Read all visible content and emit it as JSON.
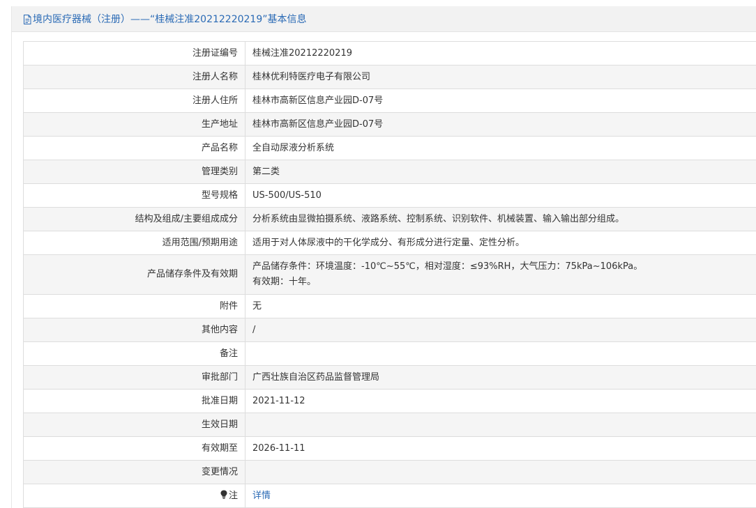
{
  "header": {
    "title": "境内医疗器械（注册）——“桂械注准20212220219”基本信息"
  },
  "rows": [
    {
      "label": "注册证编号",
      "value": "桂械注准20212220219"
    },
    {
      "label": "注册人名称",
      "value": "桂林优利特医疗电子有限公司"
    },
    {
      "label": "注册人住所",
      "value": "桂林市高新区信息产业园D-07号"
    },
    {
      "label": "生产地址",
      "value": "桂林市高新区信息产业园D-07号"
    },
    {
      "label": "产品名称",
      "value": "全自动尿液分析系统"
    },
    {
      "label": "管理类别",
      "value": "第二类"
    },
    {
      "label": "型号规格",
      "value": "US-500/US-510"
    },
    {
      "label": "结构及组成/主要组成成分",
      "value": "分析系统由显微拍摄系统、液路系统、控制系统、识别软件、机械装置、输入输出部分组成。"
    },
    {
      "label": "适用范围/预期用途",
      "value": "适用于对人体尿液中的干化学成分、有形成分进行定量、定性分析。"
    },
    {
      "label": "产品储存条件及有效期",
      "value_line1": "产品储存条件：环境温度：-10℃~55℃，相对湿度：≤93%RH，大气压力：75kPa~106kPa。",
      "value_line2": "有效期：十年。"
    },
    {
      "label": "附件",
      "value": "无"
    },
    {
      "label": "其他内容",
      "value": "/"
    },
    {
      "label": "备注",
      "value": ""
    },
    {
      "label": "审批部门",
      "value": "广西壮族自治区药品监督管理局"
    },
    {
      "label": "批准日期",
      "value": "2021-11-12"
    },
    {
      "label": "生效日期",
      "value": ""
    },
    {
      "label": "有效期至",
      "value": "2026-11-11"
    },
    {
      "label": "变更情况",
      "value": ""
    },
    {
      "label": "注",
      "value": "详情",
      "icon": "lightbulb-icon"
    }
  ],
  "colors": {
    "accent": "#2a6ab5",
    "header_bg": "#f2f2f2",
    "alt_row_bg": "#f5f5f5",
    "border": "#dddddd"
  }
}
